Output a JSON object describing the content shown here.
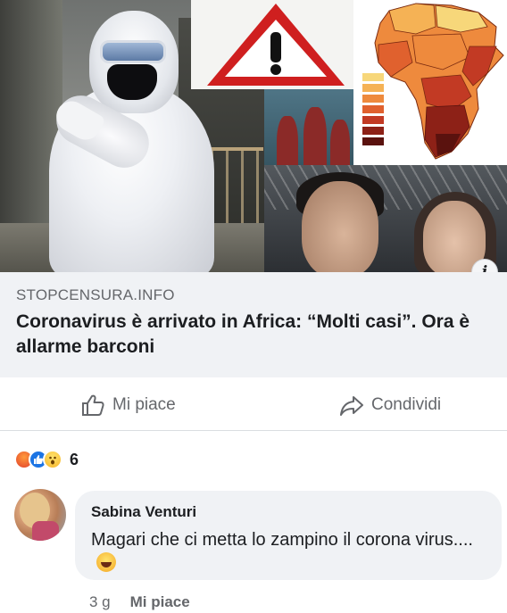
{
  "link_preview": {
    "domain": "STOPCENSURA.INFO",
    "title": "Coronavirus è arrivato in Africa: “Molti casi”. Ora è allarme barconi",
    "info_badge": "i"
  },
  "actions": {
    "like_label": "Mi piace",
    "share_label": "Condividi",
    "like_icon": "thumbs-up-icon",
    "share_icon": "share-arrow-icon"
  },
  "reactions": {
    "types": [
      "angry",
      "like",
      "wow"
    ],
    "count": "6"
  },
  "comment": {
    "author": "Sabina Venturi",
    "text": "Magari che ci metta lo zampino il corona virus....",
    "emoji": "laughing-emoji",
    "time": "3 g",
    "like_label": "Mi piace"
  },
  "colors": {
    "map_scale": [
      "#f7d77a",
      "#f5b255",
      "#ee8a3d",
      "#e0612e",
      "#c23a24",
      "#8d2117",
      "#5a120e"
    ],
    "warning_red": "#cf1f1f",
    "secondary_text": "#65676b",
    "primary_text": "#1c1e21"
  }
}
